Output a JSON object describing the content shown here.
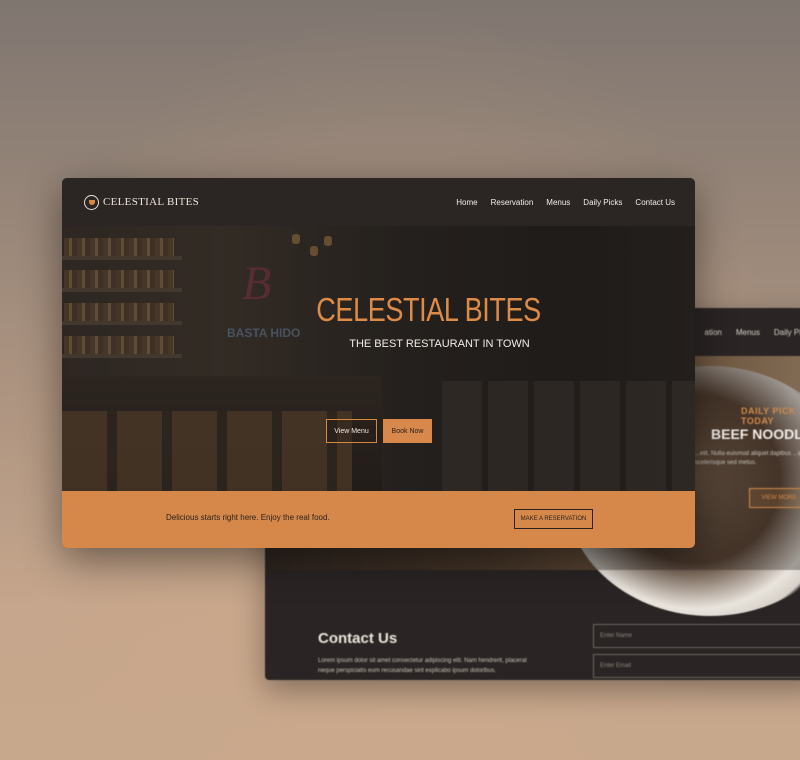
{
  "back_window": {
    "nav_items": [
      "ation",
      "Menus",
      "Daily Picks"
    ],
    "daily_tag": "DAILY PICK TODAY",
    "dish_name": "BEEF NOODLES",
    "dish_desc": "...elit. Nulla euismod aliquet dapibus ...ipsum scelerisque sed metus.",
    "view_button": "VIEW MORE",
    "contact_title": "Contact Us",
    "contact_text": "Lorem ipsum dolor sit amet consectetur adipiscing elit. Nam hendrerit, placerat neque perspiciatis eum recusandae sint explicabo ipsum doloribus.",
    "field_name_placeholder": "Enter Name",
    "field_email_placeholder": "Enter Email"
  },
  "header": {
    "logo_text": "CELESTIAL BITES",
    "nav": [
      "Home",
      "Reservation",
      "Menus",
      "Daily Picks",
      "Contact Us"
    ]
  },
  "hero": {
    "title": "CELESTIAL BITES",
    "subtitle": "THE BEST RESTAURANT IN TOWN",
    "view_menu": "View Menu",
    "book_now": "Book Now",
    "neon_sign": "BASTA HIDO"
  },
  "cta": {
    "text": "Delicious starts right here. Enjoy the real food.",
    "button": "MAKE A RESERVATION"
  },
  "colors": {
    "accent": "#d8884a",
    "dark": "#2a2524",
    "text_light": "#f3ece6"
  }
}
